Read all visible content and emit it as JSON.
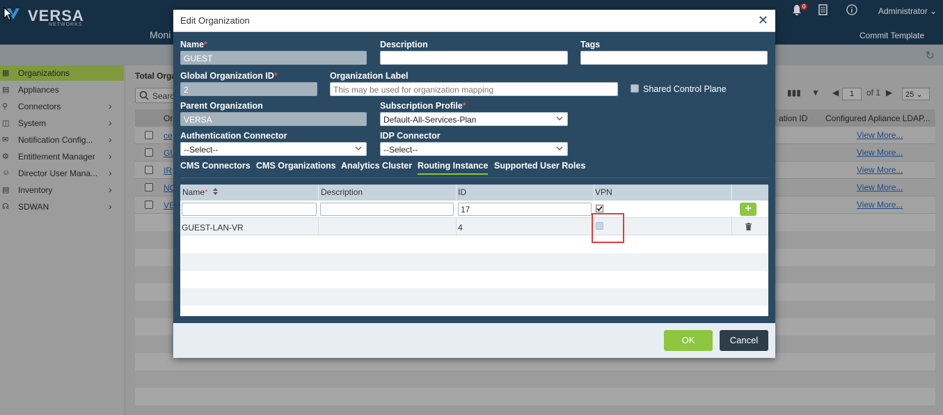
{
  "app": {
    "logo_text": "VERSA",
    "logo_sub": "NETWORKS",
    "menu_partial": "Moni",
    "notification_count": "0",
    "user": "Administrator",
    "commit_label": "Commit Template"
  },
  "sidebar": {
    "items": [
      {
        "label": "Organizations",
        "icon": "organizations-icon",
        "active": true,
        "chevron": false
      },
      {
        "label": "Appliances",
        "icon": "appliances-icon",
        "active": false,
        "chevron": false
      },
      {
        "label": "Connectors",
        "icon": "connectors-icon",
        "active": false,
        "chevron": true
      },
      {
        "label": "System",
        "icon": "system-icon",
        "active": false,
        "chevron": true
      },
      {
        "label": "Notification Config...",
        "icon": "notification-icon",
        "active": false,
        "chevron": true
      },
      {
        "label": "Entitlement Manager",
        "icon": "gear-icon",
        "active": false,
        "chevron": true
      },
      {
        "label": "Director User Mana...",
        "icon": "users-icon",
        "active": false,
        "chevron": true
      },
      {
        "label": "Inventory",
        "icon": "inventory-icon",
        "active": false,
        "chevron": true
      },
      {
        "label": "SDWAN",
        "icon": "sdwan-icon",
        "active": false,
        "chevron": true
      }
    ]
  },
  "main": {
    "total_label": "Total Orga",
    "search_placeholder": "Searc",
    "pager_page": "1",
    "pager_of": "of 1",
    "per_page": "25",
    "table": {
      "col_org": "Or",
      "col_global_id": "ation ID",
      "col_ldap": "Configured Apliance LDAP...",
      "rows": [
        {
          "org": "ce",
          "view": "View More..."
        },
        {
          "org": "GU",
          "view": "View More..."
        },
        {
          "org": "IR",
          "view": "View More..."
        },
        {
          "org": "NO",
          "view": "View More..."
        },
        {
          "org": "VE",
          "view": "View More..."
        }
      ]
    }
  },
  "modal": {
    "title": "Edit Organization",
    "fields": {
      "name_label": "Name",
      "name_value": "GUEST",
      "description_label": "Description",
      "description_value": "",
      "tags_label": "Tags",
      "tags_value": "",
      "global_id_label": "Global Organization ID",
      "global_id_value": "2",
      "org_label_label": "Organization Label",
      "org_label_placeholder": "This may be used for organization mapping",
      "shared_control_plane_label": "Shared Control Plane",
      "parent_org_label": "Parent Organization",
      "parent_org_value": "VERSA",
      "subscription_label": "Subscription Profile",
      "subscription_value": "Default-All-Services-Plan",
      "auth_connector_label": "Authentication Connector",
      "auth_connector_value": "--Select--",
      "idp_connector_label": "IDP Connector",
      "idp_connector_value": "--Select--"
    },
    "tabs": [
      {
        "label": "CMS Connectors",
        "active": false
      },
      {
        "label": "CMS Organizations",
        "active": false
      },
      {
        "label": "Analytics Cluster",
        "active": false
      },
      {
        "label": "Routing Instance",
        "active": true
      },
      {
        "label": "Supported User Roles",
        "active": false
      }
    ],
    "routing_table": {
      "headers": {
        "name": "Name",
        "description": "Description",
        "id": "ID",
        "vpn": "VPN"
      },
      "new_row": {
        "name": "",
        "description": "",
        "id": "17",
        "vpn_checked": true
      },
      "rows": [
        {
          "name": "GUEST-LAN-VR",
          "description": "",
          "id": "4",
          "vpn_checked": false
        }
      ]
    },
    "footer": {
      "ok_label": "OK",
      "cancel_label": "Cancel"
    }
  },
  "colors": {
    "accent_green": "#8dc63f",
    "modal_bg": "#2a4a63",
    "highlight_red": "#e23b3b"
  }
}
